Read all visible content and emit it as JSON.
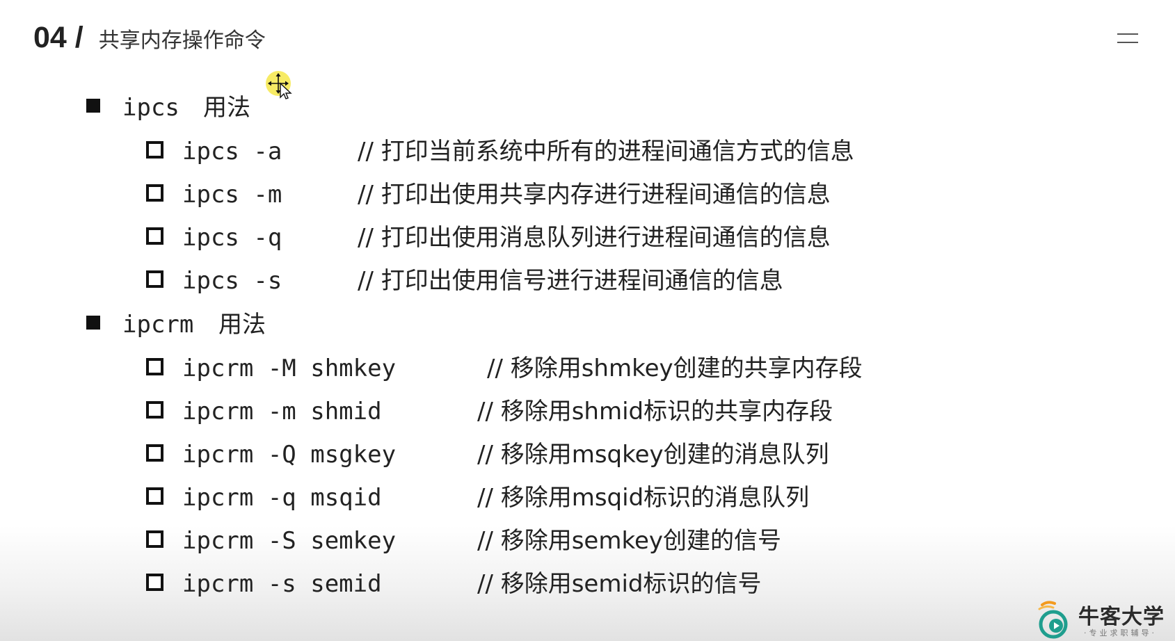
{
  "header": {
    "section_number": "04 /",
    "section_title": "共享内存操作命令"
  },
  "sections": [
    {
      "command": "ipcs",
      "label": "用法",
      "items": [
        {
          "cmd": "ipcs -a",
          "desc": "// 打印当前系统中所有的进程间通信方式的信息"
        },
        {
          "cmd": "ipcs -m",
          "desc": "// 打印出使用共享内存进行进程间通信的信息"
        },
        {
          "cmd": "ipcs -q",
          "desc": "// 打印出使用消息队列进行进程间通信的信息"
        },
        {
          "cmd": "ipcs -s",
          "desc": "// 打印出使用信号进行进程间通信的信息"
        }
      ]
    },
    {
      "command": "ipcrm",
      "label": "用法",
      "items": [
        {
          "cmd": "ipcrm -M shmkey",
          "desc": "// 移除用shmkey创建的共享内存段"
        },
        {
          "cmd": "ipcrm -m shmid",
          "desc": "// 移除用shmid标识的共享内存段"
        },
        {
          "cmd": "ipcrm -Q msgkey",
          "desc": "// 移除用msqkey创建的消息队列"
        },
        {
          "cmd": "ipcrm -q msqid",
          "desc": "// 移除用msqid标识的消息队列"
        },
        {
          "cmd": "ipcrm -S semkey",
          "desc": "// 移除用semkey创建的信号"
        },
        {
          "cmd": "ipcrm -s semid",
          "desc": "// 移除用semid标识的信号"
        }
      ]
    }
  ],
  "logo": {
    "name": "牛客大学",
    "tagline": "·专业求职辅导·"
  },
  "icons": {
    "menu": "menu-icon",
    "cursor": "move-cursor-icon"
  },
  "colors": {
    "text": "#222222",
    "cursor_highlight": "#f6e84a",
    "logo_orange": "#f39a1e",
    "logo_teal": "#1f9e8e"
  }
}
